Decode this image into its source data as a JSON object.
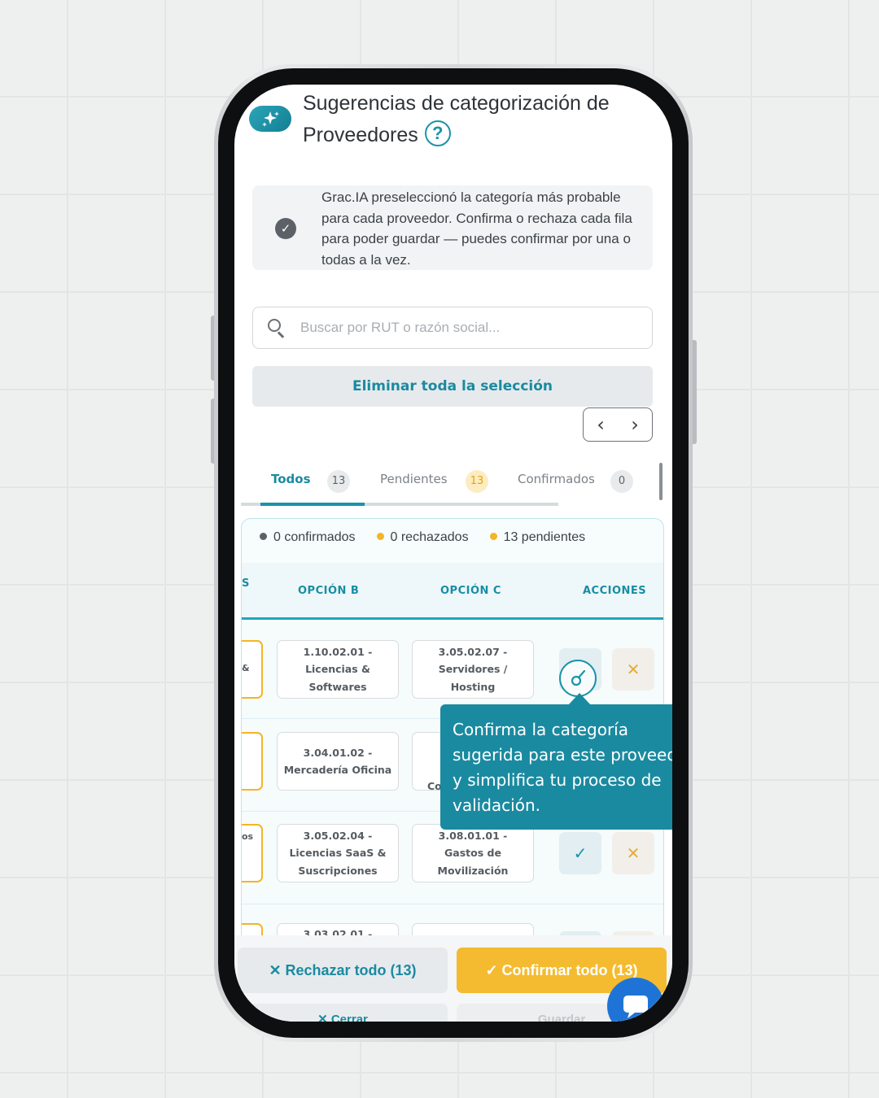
{
  "header": {
    "title": "Sugerencias de categorización de Proveedores",
    "help_icon": "question-circle-icon",
    "ai_icon": "sparkles-icon"
  },
  "info": {
    "text": "Grac.IA preseleccionó la categoría más probable para cada proveedor. Confirma o rechaza cada fila para poder guardar — puedes confirmar por una o todas a la vez."
  },
  "search": {
    "placeholder": "Buscar por RUT o razón social..."
  },
  "clear_selection_label": "Eliminar toda la selección",
  "pager": {
    "prev": "‹",
    "next": "›"
  },
  "tabs": [
    {
      "label": "Todos",
      "count": "13"
    },
    {
      "label": "Pendientes",
      "count": "13"
    },
    {
      "label": "Confirmados",
      "count": "0"
    }
  ],
  "legend": {
    "confirmed": "0 confirmados",
    "rejected": "0 rechazados",
    "pending": "13 pendientes"
  },
  "table": {
    "columns": {
      "partial": "S",
      "b": "OPCIÓN B",
      "c": "OPCIÓN C",
      "actions": "ACCIONES"
    },
    "rows": [
      {
        "a_cut": "&",
        "b": "1.10.02.01 - Licencias & Softwares",
        "c": "3.05.02.07 - Servidores / Hosting"
      },
      {
        "a_cut": "",
        "b": "3.04.01.02 - Mercadería Oficina",
        "c": "",
        "c_cut": "Co"
      },
      {
        "a_cut": "os",
        "b": "3.05.02.04 - Licencias SaaS & Suscripciones",
        "c": "3.08.01.01 - Gastos de Movilización"
      },
      {
        "a_cut": "",
        "b": "3.03.02.01 -",
        "c": ""
      }
    ]
  },
  "tooltip": {
    "line1": "Confirma la categoría",
    "line2": "sugerida para este proveedor",
    "line3": "y simplifica tu proceso de",
    "line4": "validación."
  },
  "footer": {
    "reject_all": "✕ Rechazar todo (13)",
    "confirm_all": "✓ Confirmar todo (13)",
    "close": "✕ Cerrar",
    "save": "Guardar"
  },
  "colors": {
    "accent": "#1a93a9",
    "warning": "#f4bb30",
    "confirmed_dot": "#5c6167",
    "rejected_dot": "#f4b526",
    "pending_dot": "#f4b526"
  }
}
